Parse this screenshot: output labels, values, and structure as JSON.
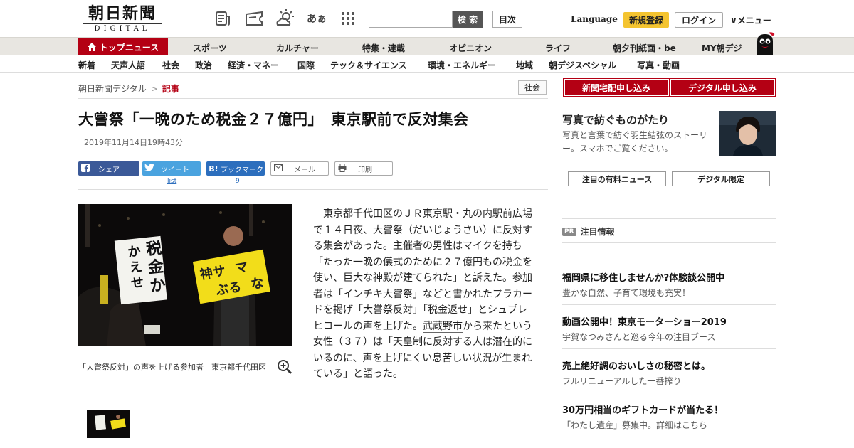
{
  "header": {
    "logo_main": "朝日新聞",
    "logo_sub": "DIGITAL",
    "search_placeholder": "",
    "search_label": "検 索",
    "index_label": "目次",
    "language_label": "Language",
    "register_label": "新規登録",
    "login_label": "ログイン",
    "menu_label": "∨メニュー",
    "font_size_icon_label": "あぁ"
  },
  "nav_primary": {
    "top": "トップニュース",
    "items": [
      "スポーツ",
      "カルチャー",
      "特集・連載",
      "オピニオン",
      "ライフ",
      "朝夕刊紙面・be",
      "MY朝デジ"
    ]
  },
  "nav_secondary": {
    "items": [
      "新着",
      "天声人語",
      "社会",
      "政治",
      "経済・マネー",
      "国際",
      "テック＆サイエンス",
      "環境・エネルギー",
      "地域",
      "朝デジスペシャル",
      "写真・動画"
    ]
  },
  "breadcrumb": {
    "home": "朝日新聞デジタル",
    "separator": ">",
    "current": "記事"
  },
  "genre_label": "社会",
  "article": {
    "title": "大嘗祭「一晩のため税金２７億円」　東京駅前で反対集会",
    "date": "2019年11月14日19時43分",
    "photo_caption": "「大嘗祭反対」の声を上げる参加者＝東京都千代田区",
    "photo_sign_left": "税金かえせ",
    "photo_sign_right": "神サマぶるな",
    "body_parts": [
      {
        "text": "東京都千代田区",
        "link": true
      },
      {
        "text": "のＪＲ",
        "link": false
      },
      {
        "text": "東京駅",
        "link": true
      },
      {
        "text": "・",
        "link": false
      },
      {
        "text": "丸の内",
        "link": true
      },
      {
        "text": "駅前広場で１４日夜、大嘗祭（だいじょうさい）に反対する集会があった。主催者の男性はマイクを持ち「たった一晩の儀式のために２７億円もの税金を使い、巨大な神殿が建てられた」と訴えた。参加者は「インチキ大嘗祭」などと書かれたプラカードを掲げ「大嘗祭反対」「税金返せ」とシュプレヒコールの声を上げた。",
        "link": false
      },
      {
        "text": "武蔵野市",
        "link": true
      },
      {
        "text": "から来たという女性（３７）は「",
        "link": false
      },
      {
        "text": "天皇制",
        "link": true
      },
      {
        "text": "に反対する人は潜在的にいるのに、声を上げにくい息苦しい状況が生まれている」と語った。",
        "link": false
      }
    ]
  },
  "share": {
    "facebook": "シェア",
    "twitter": "ツイート",
    "twitter_count": "list",
    "hatena": "ブックマーク",
    "hatena_count": "9",
    "mail": "メール",
    "print": "印刷"
  },
  "sidebar": {
    "subscribe_paper": "新聞宅配申し込み",
    "subscribe_digital": "デジタル申し込み",
    "promo_title": "写真で紡ぐものがたり",
    "promo_desc": "写真と言葉で紡ぐ羽生結弦のストーリー。スマホでご覧ください。",
    "tab_paid_news": "注目の有料ニュース",
    "tab_digital_only": "デジタル限定",
    "pr_badge": "PR",
    "pr_heading": "注目情報",
    "pr_items": [
      {
        "title": "福岡県に移住しませんか?体験談公開中",
        "desc": "豊かな自然、子育て環境も充実！"
      },
      {
        "title": "動画公開中！東京モーターショー2019",
        "desc": "宇賀なつみさんと巡る今年の注目ブース"
      },
      {
        "title": "売上絶好調のおいしさの秘密とは。",
        "desc": "フルリニューアルした一番搾り"
      },
      {
        "title": "30万円相当のギフトカードが当たる！",
        "desc": "「わたし遺産」募集中。詳細はこちら"
      }
    ]
  },
  "colors": {
    "brand_red": "#b40014",
    "facebook": "#3b5998",
    "twitter": "#4aa3df",
    "hatena": "#2c6ebd",
    "register_yellow": "#f4c430"
  }
}
